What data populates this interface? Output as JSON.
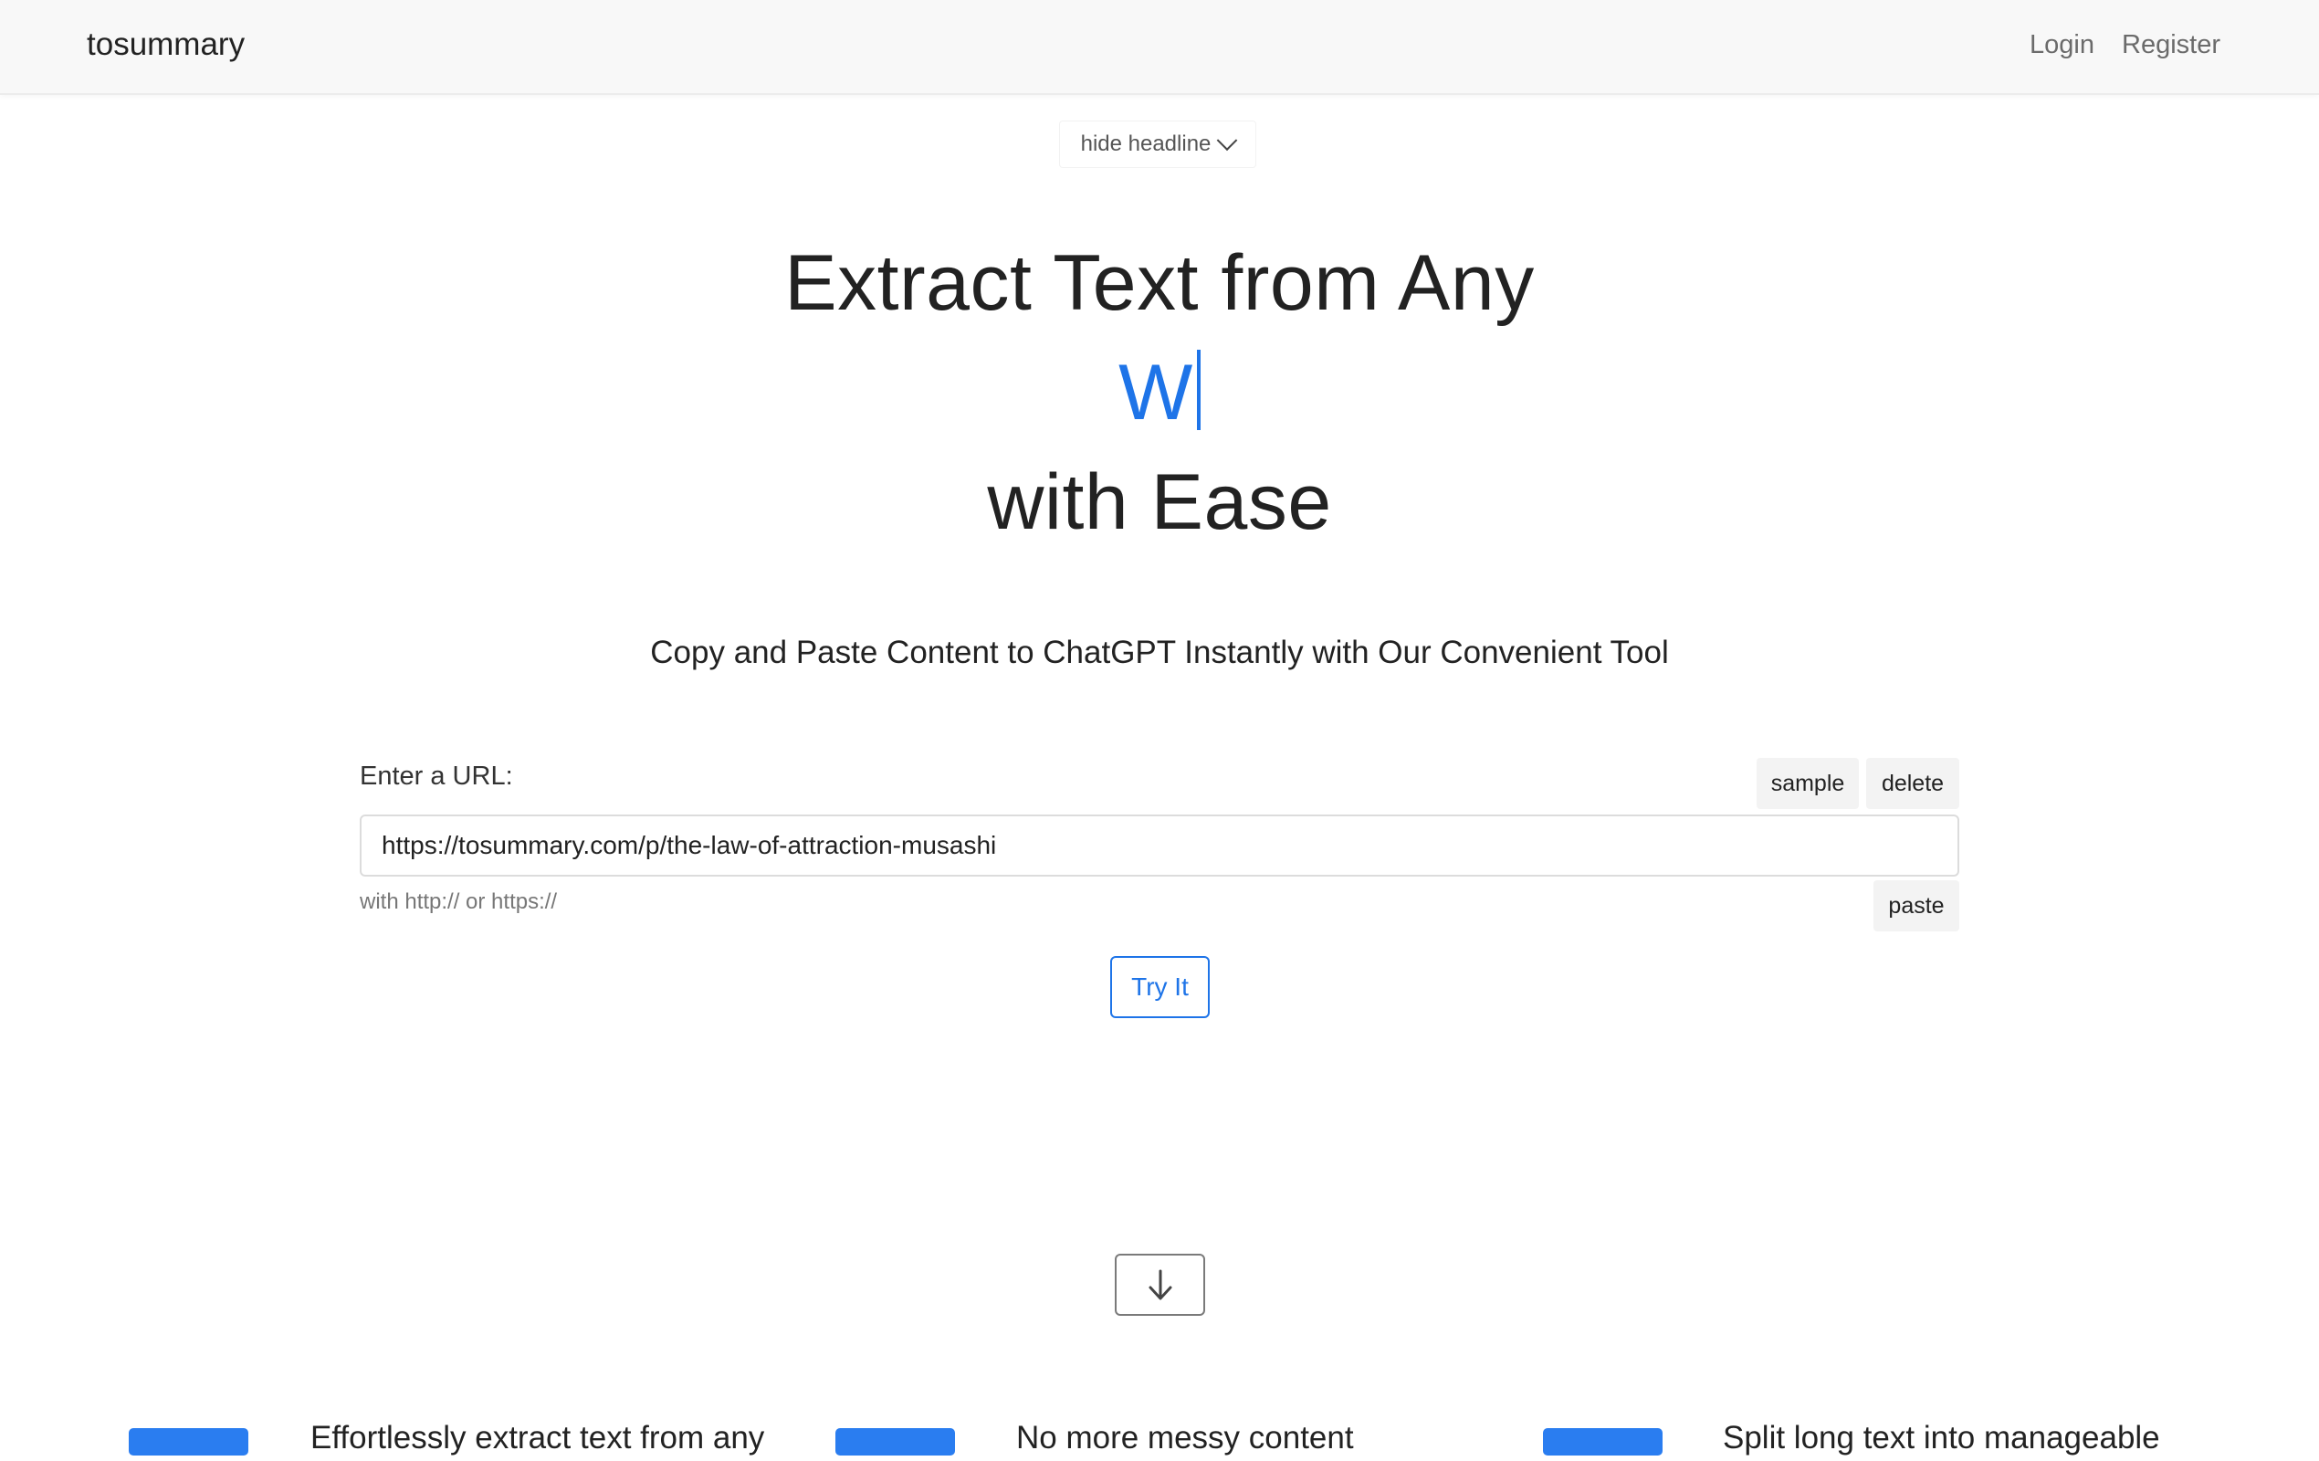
{
  "header": {
    "brand": "tosummary",
    "nav": {
      "login": "Login",
      "register": "Register"
    }
  },
  "toggle": {
    "label": "hide headline"
  },
  "hero": {
    "line1": "Extract Text from Any",
    "typed": "W",
    "line3": "with Ease",
    "subtitle": "Copy and Paste Content to ChatGPT Instantly with Our Convenient Tool"
  },
  "form": {
    "label": "Enter a URL:",
    "sample_label": "sample",
    "delete_label": "delete",
    "url_value": "https://tosummary.com/p/the-law-of-attraction-musashi",
    "hint": "with http:// or https://",
    "paste_label": "paste",
    "submit_label": "Try It"
  },
  "icons": {
    "toggle": "chevron-down-icon",
    "scroll": "arrow-down-icon"
  },
  "colors": {
    "accent": "#1e74e8",
    "feature_icon": "#2a7df0"
  },
  "features": [
    {
      "text": "Effortlessly extract text from any"
    },
    {
      "text": "No more messy content"
    },
    {
      "text": "Split long text into manageable"
    }
  ]
}
